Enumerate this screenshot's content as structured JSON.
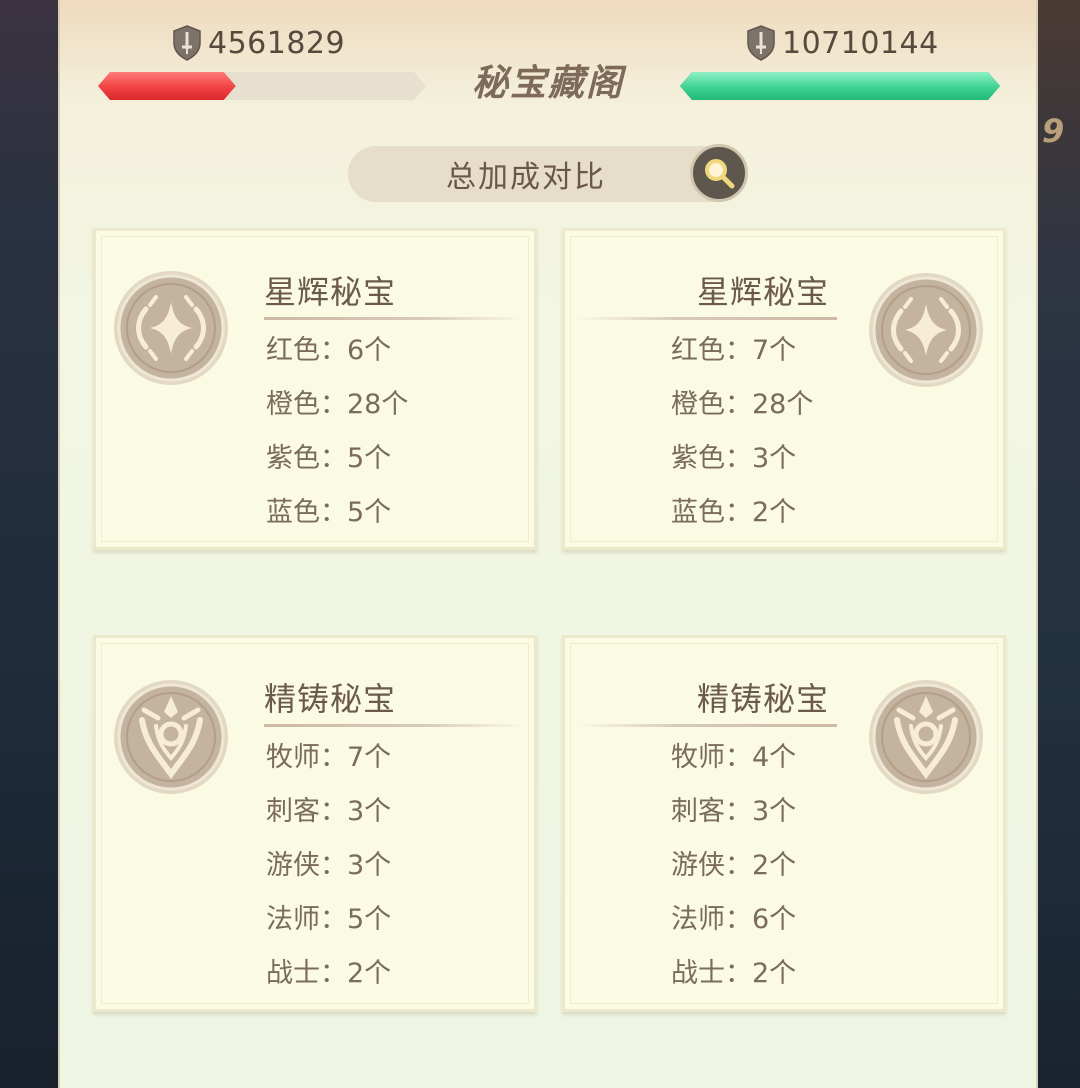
{
  "header": {
    "title": "秘宝藏阁",
    "left_power": "4561829",
    "right_power": "10710144",
    "left_bar_fraction": 0.42,
    "right_bar_fraction": 1.0,
    "left_bar_color": "#ef3e40",
    "right_bar_color": "#3fd393",
    "power_icon": "sword-shield-icon"
  },
  "compare_button": {
    "label": "总加成对比",
    "icon": "search-icon"
  },
  "background": {
    "right_edge_digit": "9"
  },
  "cards": {
    "starlight_left": {
      "title": "星辉秘宝",
      "emblem": "starlight-emblem-icon",
      "stats": [
        "红色：6个",
        "橙色：28个",
        "紫色：5个",
        "蓝色：5个"
      ]
    },
    "starlight_right": {
      "title": "星辉秘宝",
      "emblem": "starlight-emblem-icon",
      "stats": [
        "红色：7个",
        "橙色：28个",
        "紫色：3个",
        "蓝色：2个"
      ]
    },
    "forged_left": {
      "title": "精铸秘宝",
      "emblem": "forged-emblem-icon",
      "stats": [
        "牧师：7个",
        "刺客：3个",
        "游侠：3个",
        "法师：5个",
        "战士：2个"
      ]
    },
    "forged_right": {
      "title": "精铸秘宝",
      "emblem": "forged-emblem-icon",
      "stats": [
        "牧师：4个",
        "刺客：3个",
        "游侠：2个",
        "法师：6个",
        "战士：2个"
      ]
    }
  }
}
